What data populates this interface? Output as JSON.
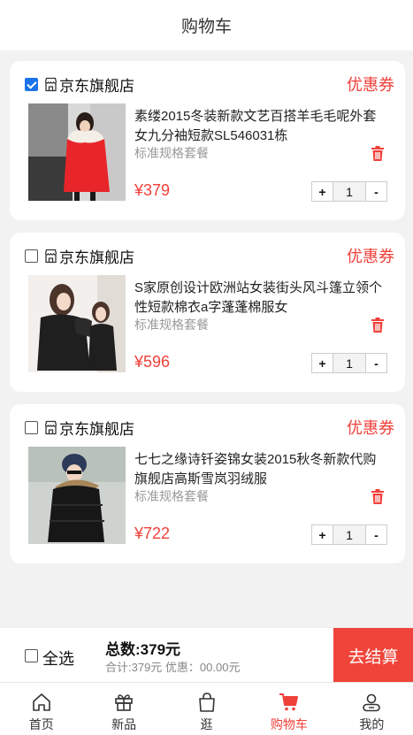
{
  "header": {
    "title": "购物车"
  },
  "items": [
    {
      "checked": true,
      "shop": "京东旗舰店",
      "coupon": "优惠券",
      "title": "素缕2015冬装新款文艺百搭羊毛毛呢外套女九分袖短款SL546031栋",
      "spec": "标准规格套餐",
      "price": "¥379",
      "qty": "1",
      "minus": "-",
      "plus": "+",
      "image": "woman-red-coat-photo"
    },
    {
      "checked": false,
      "shop": "京东旗舰店",
      "coupon": "优惠券",
      "title": "S家原创设计欧洲站女装街头风斗篷立领个性短款棉衣a字蓬蓬棉服女",
      "spec": "标准规格套餐",
      "price": "¥596",
      "qty": "1",
      "minus": "-",
      "plus": "+",
      "image": "woman-black-cotton-coat-photo"
    },
    {
      "checked": false,
      "shop": "京东旗舰店",
      "coupon": "优惠券",
      "title": "七七之缘诗钎姿锦女装2015秋冬新款代购旗舰店高斯雪岚羽绒服",
      "spec": "标准规格套餐",
      "price": "¥722",
      "qty": "1",
      "minus": "-",
      "plus": "+",
      "image": "woman-down-jacket-photo"
    }
  ],
  "checkout": {
    "select_all": "全选",
    "total": "总数:379元",
    "summary": "合计:379元 优惠：00.00元",
    "pay_label": "去结算"
  },
  "tabs": [
    {
      "label": "首页",
      "icon": "home-icon"
    },
    {
      "label": "新品",
      "icon": "gift-icon"
    },
    {
      "label": "逛",
      "icon": "bag-icon"
    },
    {
      "label": "购物车",
      "icon": "cart-icon",
      "active": true
    },
    {
      "label": "我的",
      "icon": "user-icon"
    }
  ],
  "colors": {
    "accent": "#f0403a",
    "checkbox": "#1a73e8"
  }
}
